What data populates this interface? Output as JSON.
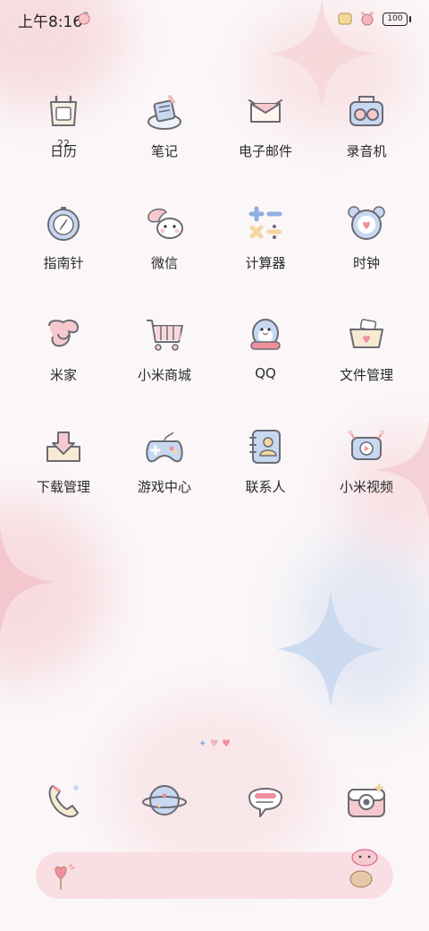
{
  "status_bar": {
    "time": "上午8:16",
    "battery": "100"
  },
  "apps": [
    {
      "label": "日历",
      "icon": "calendar-icon",
      "badge": "22"
    },
    {
      "label": "笔记",
      "icon": "notes-icon"
    },
    {
      "label": "电子邮件",
      "icon": "email-icon"
    },
    {
      "label": "录音机",
      "icon": "recorder-icon"
    },
    {
      "label": "指南针",
      "icon": "compass-icon"
    },
    {
      "label": "微信",
      "icon": "wechat-icon"
    },
    {
      "label": "计算器",
      "icon": "calculator-icon"
    },
    {
      "label": "时钟",
      "icon": "clock-icon"
    },
    {
      "label": "米家",
      "icon": "mijia-icon"
    },
    {
      "label": "小米商城",
      "icon": "mi-store-icon"
    },
    {
      "label": "QQ",
      "icon": "qq-icon"
    },
    {
      "label": "文件管理",
      "icon": "file-manager-icon"
    },
    {
      "label": "下载管理",
      "icon": "download-manager-icon"
    },
    {
      "label": "游戏中心",
      "icon": "game-center-icon"
    },
    {
      "label": "联系人",
      "icon": "contacts-icon"
    },
    {
      "label": "小米视频",
      "icon": "mi-video-icon"
    }
  ],
  "dock": [
    {
      "icon": "phone-icon"
    },
    {
      "icon": "browser-planet-icon"
    },
    {
      "icon": "messages-icon"
    },
    {
      "icon": "camera-icon"
    }
  ],
  "colors": {
    "pink": "#f6c9cf",
    "blue": "#c8d8f1",
    "outline": "#6b6b74",
    "cream": "#f7ead2"
  }
}
